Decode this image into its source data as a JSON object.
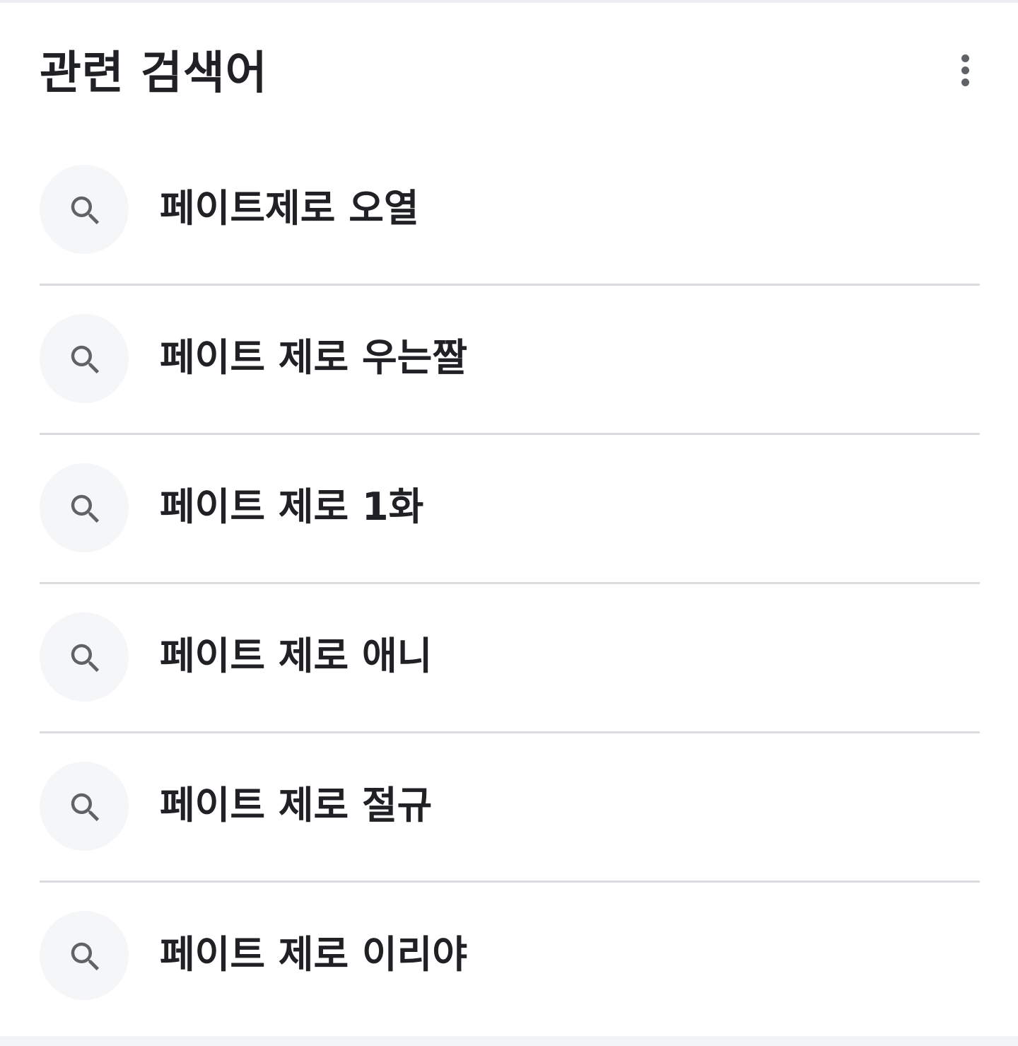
{
  "section": {
    "title": "관련 검색어",
    "more_icon": "more-vert-icon"
  },
  "related_searches": [
    {
      "label": "페이트제로 오열",
      "icon": "search-icon"
    },
    {
      "label": "페이트 제로 우는짤",
      "icon": "search-icon"
    },
    {
      "label": "페이트 제로 1화",
      "icon": "search-icon"
    },
    {
      "label": "페이트 제로 애니",
      "icon": "search-icon"
    },
    {
      "label": "페이트 제로 절규",
      "icon": "search-icon"
    },
    {
      "label": "페이트 제로 이리야",
      "icon": "search-icon"
    }
  ],
  "colors": {
    "text": "#202124",
    "icon": "#5f6368",
    "icon_bg": "#f5f6f8",
    "divider": "#dadce0"
  }
}
